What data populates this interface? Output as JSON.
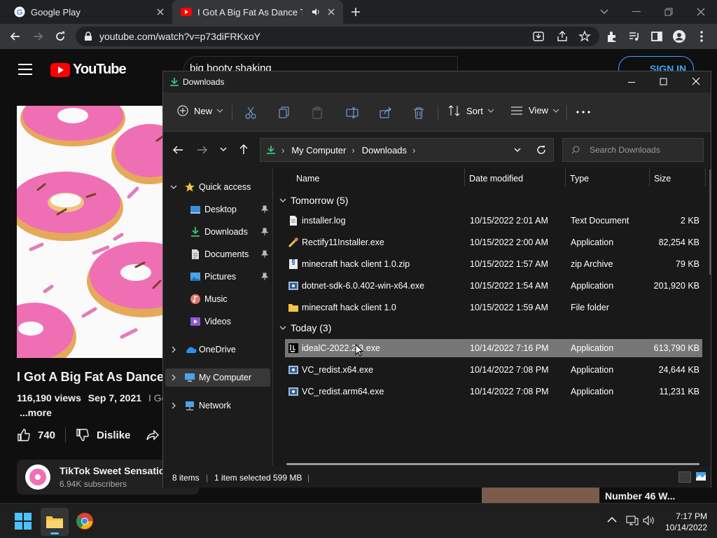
{
  "browser": {
    "tabs": [
      {
        "title": "Google Play"
      },
      {
        "title": "I Got A Big Fat As Dance TikTok"
      }
    ],
    "url": "youtube.com/watch?v=p73diFRKxoY"
  },
  "youtube": {
    "logo_text": "YouTube",
    "search_query": "big booty shaking",
    "sign_in_label": "SIGN IN",
    "video_title": "I Got A Big Fat As Dance",
    "views": "116,190 views",
    "date": "Sep 7, 2021",
    "desc_snippet": "I Got",
    "more_label": "...more",
    "like_count": "740",
    "dislike_label": "Dislike",
    "channel_name": "TikTok Sweet Sensation",
    "channel_subs": "6.94K subscribers",
    "rec_title": "Number 46 W..."
  },
  "explorer": {
    "window_title": "Downloads",
    "toolbar": {
      "new": "New",
      "sort": "Sort",
      "view": "View"
    },
    "breadcrumb": [
      "My Computer",
      "Downloads"
    ],
    "search_placeholder": "Search Downloads",
    "sidebar": [
      {
        "label": "Quick access"
      },
      {
        "label": "Desktop"
      },
      {
        "label": "Downloads"
      },
      {
        "label": "Documents"
      },
      {
        "label": "Pictures"
      },
      {
        "label": "Music"
      },
      {
        "label": "Videos"
      },
      {
        "label": "OneDrive"
      },
      {
        "label": "My Computer"
      },
      {
        "label": "Network"
      }
    ],
    "columns": {
      "name": "Name",
      "date": "Date modified",
      "type": "Type",
      "size": "Size"
    },
    "groups": [
      {
        "label": "Tomorrow (5)",
        "files": [
          {
            "name": "installer.log",
            "date": "10/15/2022 2:01 AM",
            "type": "Text Document",
            "size": "2 KB"
          },
          {
            "name": "Rectify11Installer.exe",
            "date": "10/15/2022 2:00 AM",
            "type": "Application",
            "size": "82,254 KB"
          },
          {
            "name": "minecraft hack client 1.0.zip",
            "date": "10/15/2022 1:57 AM",
            "type": "zip Archive",
            "size": "79 KB"
          },
          {
            "name": "dotnet-sdk-6.0.402-win-x64.exe",
            "date": "10/15/2022 1:54 AM",
            "type": "Application",
            "size": "201,920 KB"
          },
          {
            "name": "minecraft hack client 1.0",
            "date": "10/15/2022 1:59 AM",
            "type": "File folder",
            "size": ""
          }
        ]
      },
      {
        "label": "Today (3)",
        "files": [
          {
            "name": "idealC-2022.2.3.exe",
            "date": "10/14/2022 7:16 PM",
            "type": "Application",
            "size": "613,790 KB"
          },
          {
            "name": "VC_redist.x64.exe",
            "date": "10/14/2022 7:08 PM",
            "type": "Application",
            "size": "24,644 KB"
          },
          {
            "name": "VC_redist.arm64.exe",
            "date": "10/14/2022 7:08 PM",
            "type": "Application",
            "size": "11,231 KB"
          }
        ]
      }
    ],
    "status": {
      "count": "8 items",
      "selected": "1 item selected",
      "selected_size": "599 MB"
    }
  },
  "taskbar": {
    "time": "7:17 PM",
    "date": "10/14/2022"
  },
  "colors": {
    "accent": "#3ea6ff",
    "youtube_red": "#ff0000",
    "selection": "#777777",
    "folder": "#f4c542"
  }
}
